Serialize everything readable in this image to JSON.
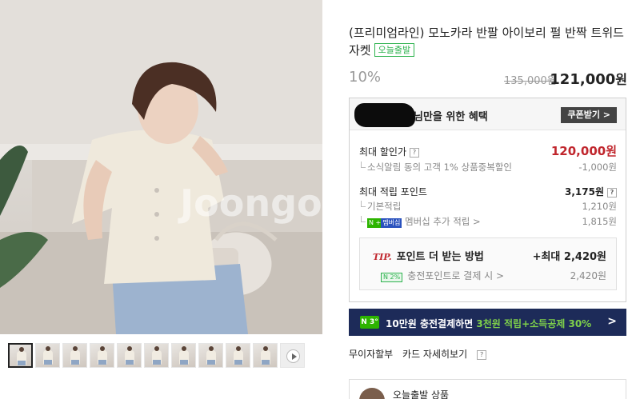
{
  "product": {
    "title": "(프리미엄라인) 모노카라 반팔 아이보리 펄 반짝 트위드자켓",
    "badge_today": "오늘출발",
    "discount": "10%",
    "original_price": "135,000원",
    "final_price_num": "121,000",
    "final_price_unit": "원"
  },
  "gallery": {
    "thumbnail_count": 10,
    "watermark_text": "Joongonara"
  },
  "benefit": {
    "title": "님만을 위한 혜택",
    "coupon_button": "쿠폰받기 >",
    "max_discount_label": "최대 할인가",
    "max_discount_value": "120,000원",
    "alarm_label": "소식알림 동의 고객 1% 상품중복할인",
    "alarm_value": "-1,000원",
    "max_point_label": "최대 적립 포인트",
    "max_point_value": "3,175원",
    "basic_label": "기본적립",
    "basic_value": "1,210원",
    "membership_badge_n": "N +",
    "membership_badge_text": "멤버십",
    "membership_label": "멤버십 추가 적립 >",
    "membership_value": "1,815원",
    "tip_mark": "TIP.",
    "tip_label": "포인트 더 받는 방법",
    "tip_value": "+최대 2,420원",
    "charge_badge": "N 2%",
    "charge_label": "충전포인트로 결제 시 >",
    "charge_value": "2,420원"
  },
  "banner": {
    "logo": "N 3°",
    "text_pre": "10만원 충전결제하면 ",
    "text_hi": "3천원 적립+소득공제 30%",
    "chevron": ">"
  },
  "links": {
    "interest_free": "무이자할부",
    "card_benefit": "카드 자세히보기"
  },
  "seller": {
    "name": "오늘출발 상품"
  },
  "colors": {
    "accent_red": "#c0262d",
    "naver_green": "#2db400",
    "banner_navy": "#1d2b59"
  }
}
